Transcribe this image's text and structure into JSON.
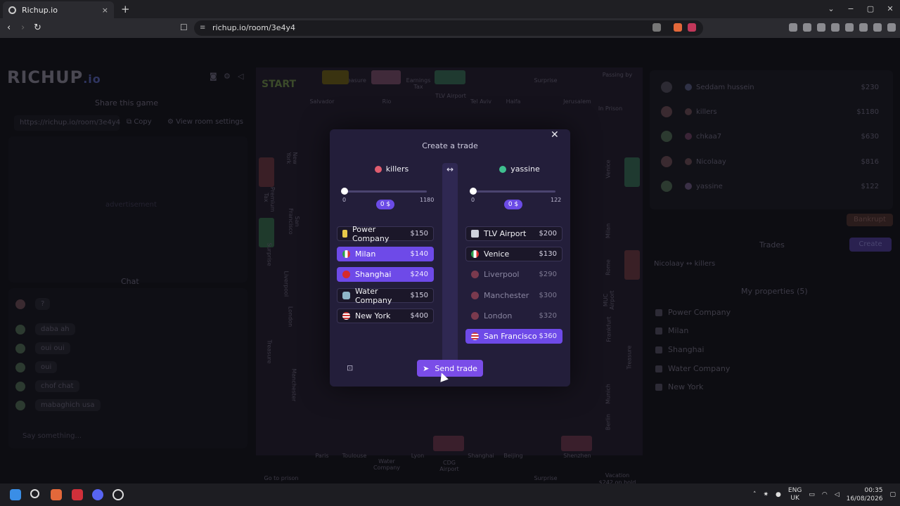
{
  "browser": {
    "tab_title": "Richup.io",
    "tab_close": "×",
    "new_tab": "+",
    "url": "richup.io/room/3e4y4",
    "win_min": "−",
    "win_max": "▢",
    "win_close": "✕",
    "win_menu": "⌄"
  },
  "left": {
    "logo": "RICHUP",
    "logo_suffix": ".io",
    "share_title": "Share this game",
    "share_url": "https://richup.io/room/3e4y4",
    "copy_label": "Copy",
    "room_settings": "View room settings",
    "advertisement": "advertisement",
    "chat_title": "Chat",
    "chat_messages": [
      "?",
      "daba ah",
      "oui oui",
      "oui",
      "chof chat",
      "mabaghich usa"
    ],
    "chat_placeholder": "Say something..."
  },
  "board": {
    "start": "START",
    "top_cells": [
      "Salvador",
      "Treasure",
      "Rio",
      "Earnings Tax",
      "TLV Airport",
      "Tel Aviv",
      "Haifa",
      "Surprise",
      "Jerusalem",
      "Passing by"
    ],
    "left_cells": [
      "New York",
      "Premium Tax",
      "San Francisco",
      "Surprise",
      "Liverpool",
      "London",
      "Treasure",
      "Manchester"
    ],
    "right_cells": [
      "Venice",
      "Milan",
      "Rome",
      "MUC Airport",
      "Frankfurt",
      "Treasure",
      "Munich",
      "Berlin"
    ],
    "bottom_cells": [
      "Go to prison",
      "Paris",
      "Toulouse",
      "Water Company",
      "Lyon",
      "CDG Airport",
      "Shanghai",
      "Beijing",
      "Surprise",
      "Shenzhen",
      "Vacation"
    ],
    "vacation_sub": "$242 on hold",
    "in_prison": "In Prison"
  },
  "right": {
    "players": [
      {
        "name": "Seddam hussein",
        "money": "$230"
      },
      {
        "name": "killers",
        "money": "$1180"
      },
      {
        "name": "chkaa7",
        "money": "$630"
      },
      {
        "name": "Nicolaay",
        "money": "$816"
      },
      {
        "name": "yassine",
        "money": "$122"
      }
    ],
    "bankrupt": "Bankrupt",
    "trades_title": "Trades",
    "create_label": "Create",
    "trade_from": "Nicolaay",
    "trade_to": "killers",
    "my_properties_title": "My properties (5)",
    "my_properties": [
      "Power Company",
      "Milan",
      "Shanghai",
      "Water Company",
      "New York"
    ]
  },
  "modal": {
    "title": "Create a trade",
    "close": "✕",
    "swap": "↔",
    "left_player": {
      "name": "killers",
      "color": "#e05d6f",
      "min": "0",
      "max": "1180",
      "offer": "0 $"
    },
    "right_player": {
      "name": "yassine",
      "color": "#3fbf8f",
      "min": "0",
      "max": "122",
      "offer": "0 $"
    },
    "left_props": [
      {
        "name": "Power Company",
        "price": "$150",
        "icon": "lightning-icon",
        "state": "own"
      },
      {
        "name": "Milan",
        "price": "$140",
        "icon": "italy-flag-icon",
        "state": "sel"
      },
      {
        "name": "Shanghai",
        "price": "$240",
        "icon": "china-flag-icon",
        "state": "sel"
      },
      {
        "name": "Water Company",
        "price": "$150",
        "icon": "water-tap-icon",
        "state": "own"
      },
      {
        "name": "New York",
        "price": "$400",
        "icon": "usa-flag-icon",
        "state": "own"
      }
    ],
    "right_props": [
      {
        "name": "TLV Airport",
        "price": "$200",
        "icon": "airplane-icon",
        "state": "own"
      },
      {
        "name": "Venice",
        "price": "$130",
        "icon": "italy-flag-icon",
        "state": "own"
      },
      {
        "name": "Liverpool",
        "price": "$290",
        "icon": "uk-flag-icon",
        "state": "off"
      },
      {
        "name": "Manchester",
        "price": "$300",
        "icon": "uk-flag-icon",
        "state": "off"
      },
      {
        "name": "London",
        "price": "$320",
        "icon": "uk-flag-icon",
        "state": "off"
      },
      {
        "name": "San Francisco",
        "price": "$360",
        "icon": "usa-flag-icon",
        "state": "sel"
      }
    ],
    "send_label": "Send trade"
  },
  "taskbar": {
    "lang_top": "ENG",
    "lang_bottom": "UK",
    "time": "00:35",
    "date": "16/08/2026"
  }
}
